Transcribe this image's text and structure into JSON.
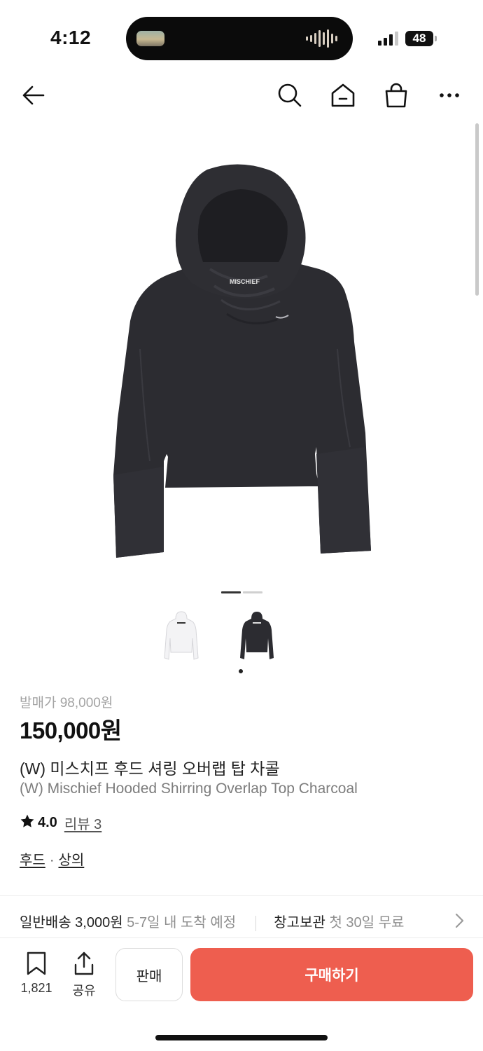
{
  "status_bar": {
    "time": "4:12",
    "battery": "48"
  },
  "nav": {
    "back_icon": "arrow-left-icon",
    "search_icon": "search-icon",
    "home_icon": "home-icon",
    "cart_icon": "shopping-bag-icon",
    "more_icon": "more-horizontal-icon"
  },
  "gallery": {
    "current_index": 1,
    "total": 2,
    "colors": [
      "#f4f4f6",
      "#2c2c31"
    ],
    "selected_color": "#2c2c31"
  },
  "product": {
    "original_price": "발매가 98,000원",
    "price": "150,000원",
    "name_ko": "(W) 미스치프 후드 셔링 오버랩 탑 차콜",
    "name_en": "(W) Mischief Hooded Shirring Overlap Top Charcoal",
    "rating": "4.0",
    "reviews": "리뷰 3",
    "category_1": "후드",
    "category_sep": "·",
    "category_2": "상의",
    "garment_logo": "MISCHIEF"
  },
  "shipping": {
    "standard_label": "일반배송 3,000원",
    "standard_eta": "5-7일 내 도착 예정",
    "storage_label": "창고보관",
    "storage_promo": "첫 30일 무료"
  },
  "bottom_bar": {
    "bookmark_count": "1,821",
    "share_label": "공유",
    "sell_label": "판매",
    "buy_label": "구매하기",
    "accent_color": "#ee5e4f"
  }
}
